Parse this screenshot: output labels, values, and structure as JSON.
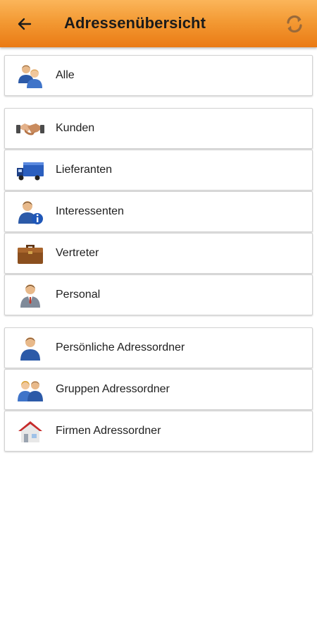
{
  "header": {
    "title": "Adressenübersicht",
    "back_icon": "arrow-left-icon",
    "refresh_icon": "refresh-icon",
    "bar_color": "#f39a34"
  },
  "groups": [
    {
      "items": [
        {
          "label": "Alle",
          "icon": "people-icon"
        }
      ]
    },
    {
      "items": [
        {
          "label": "Kunden",
          "icon": "handshake-icon"
        },
        {
          "label": "Lieferanten",
          "icon": "truck-icon"
        },
        {
          "label": "Interessenten",
          "icon": "person-info-icon"
        },
        {
          "label": "Vertreter",
          "icon": "briefcase-icon"
        },
        {
          "label": "Personal",
          "icon": "employee-icon"
        }
      ]
    },
    {
      "items": [
        {
          "label": "Persönliche Adressordner",
          "icon": "person-icon"
        },
        {
          "label": "Gruppen Adressordner",
          "icon": "group-icon"
        },
        {
          "label": "Firmen Adressordner",
          "icon": "house-icon"
        }
      ]
    }
  ]
}
